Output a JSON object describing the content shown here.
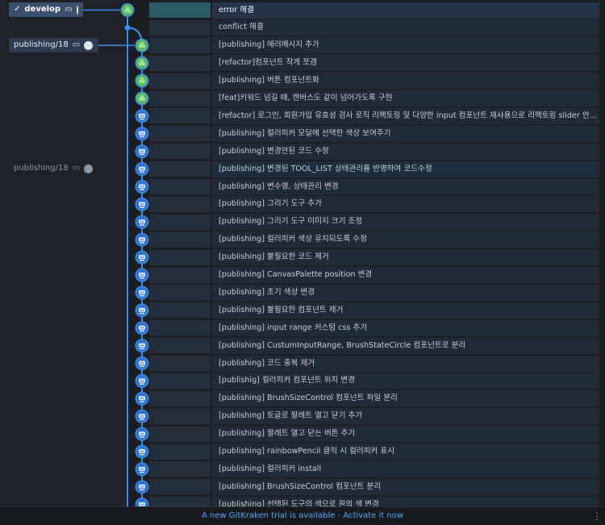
{
  "refs": [
    {
      "label": "develop",
      "row": 0,
      "style": "current",
      "icons": [
        "check-icon",
        "laptop-icon",
        "avatar-icon"
      ]
    },
    {
      "label": "publishing/18",
      "row": 2,
      "style": "local",
      "icons": [
        "laptop-icon",
        "avatar-icon"
      ]
    },
    {
      "label": "publishing/18",
      "row": 9,
      "style": "remote",
      "icons": [
        "laptop-icon",
        "avatar-icon"
      ]
    }
  ],
  "commits": [
    {
      "message": "error 해결",
      "avatar": "b"
    },
    {
      "message": "conflict 해결",
      "avatar": "dot"
    },
    {
      "message": "[publishing] 에러메시지 추가",
      "avatar": "b"
    },
    {
      "message": "[refactor]컴포넌트 작게 쪼갬",
      "avatar": "b"
    },
    {
      "message": "[publishing] 버튼 컴포넌트화",
      "avatar": "b"
    },
    {
      "message": "[feat]키워드 넘길 때, 캔버스도 같이 넘어가도록 구현",
      "avatar": "b"
    },
    {
      "message": "[refactor] 로그인, 회원가입 유효성 검사 로직 리팩토링 및 다양한 input 컴포넌트 재사용으로 리팩토링 slider 안 생기던 스크...",
      "avatar": "a"
    },
    {
      "message": "[publishing] 컬러피커 모달에 선택한 색상 보여주기",
      "avatar": "a"
    },
    {
      "message": "[publishing] 변경안된 코드 수정",
      "avatar": "a"
    },
    {
      "message": "[publishing] 변경된 TOOL_LIST 상태관리를 반영하여 코드수정",
      "avatar": "a"
    },
    {
      "message": "[publishing] 변수명, 상태관리 변경",
      "avatar": "a"
    },
    {
      "message": "[publishing] 그리기 도구 추가",
      "avatar": "a"
    },
    {
      "message": "[publishing] 그리기 도구 이미지 크기 조정",
      "avatar": "a"
    },
    {
      "message": "[publishing] 컬러피커 색상 유지되도록 수정",
      "avatar": "a"
    },
    {
      "message": "[publishing] 불필요한 코드 제거",
      "avatar": "a"
    },
    {
      "message": "[publishing] CanvasPalette position 변경",
      "avatar": "a"
    },
    {
      "message": "[publishing] 초기 색상 변경",
      "avatar": "a"
    },
    {
      "message": "[publishing] 불필요한 컴포넌트 제거",
      "avatar": "a"
    },
    {
      "message": "[publishing] input range 커스텀 css 추가",
      "avatar": "a"
    },
    {
      "message": "[publishing] CustumInputRange, BrushStateCircle 컴포넌트로 분리",
      "avatar": "a"
    },
    {
      "message": "[publishing] 코드 중복 제거",
      "avatar": "a"
    },
    {
      "message": "[publishig] 컬러피커 컴포넌트 위치 변경",
      "avatar": "a"
    },
    {
      "message": "[publishing] BrushSizeControl 컴포넌트 파일 분리",
      "avatar": "a"
    },
    {
      "message": "[publishing] 토글로 팔레트 열고 닫기 추가",
      "avatar": "a"
    },
    {
      "message": "[publishing] 팔레트 열고 닫는 버튼 추가",
      "avatar": "a"
    },
    {
      "message": "[publishing] rainbowPencil 클릭 시 컬러피커 표시",
      "avatar": "a"
    },
    {
      "message": "[publishing] 컬러피커 install",
      "avatar": "a"
    },
    {
      "message": "[publishing] BrushSizeControl 컴포넌트 분리",
      "avatar": "a"
    },
    {
      "message": "[publishing] 선택된 도구의 색으로 원의 색 변경",
      "avatar": "a"
    }
  ],
  "highlight_rows": [
    0,
    9
  ],
  "banner": {
    "text": "A new GitKraken trial is available - Activate it now"
  },
  "colors": {
    "lane": "#3b8ce8",
    "avatar_a_bg": "#2f6fd0",
    "avatar_b_bg": "#5cb85c"
  },
  "icons": {
    "more": "vertical-dots-icon"
  }
}
